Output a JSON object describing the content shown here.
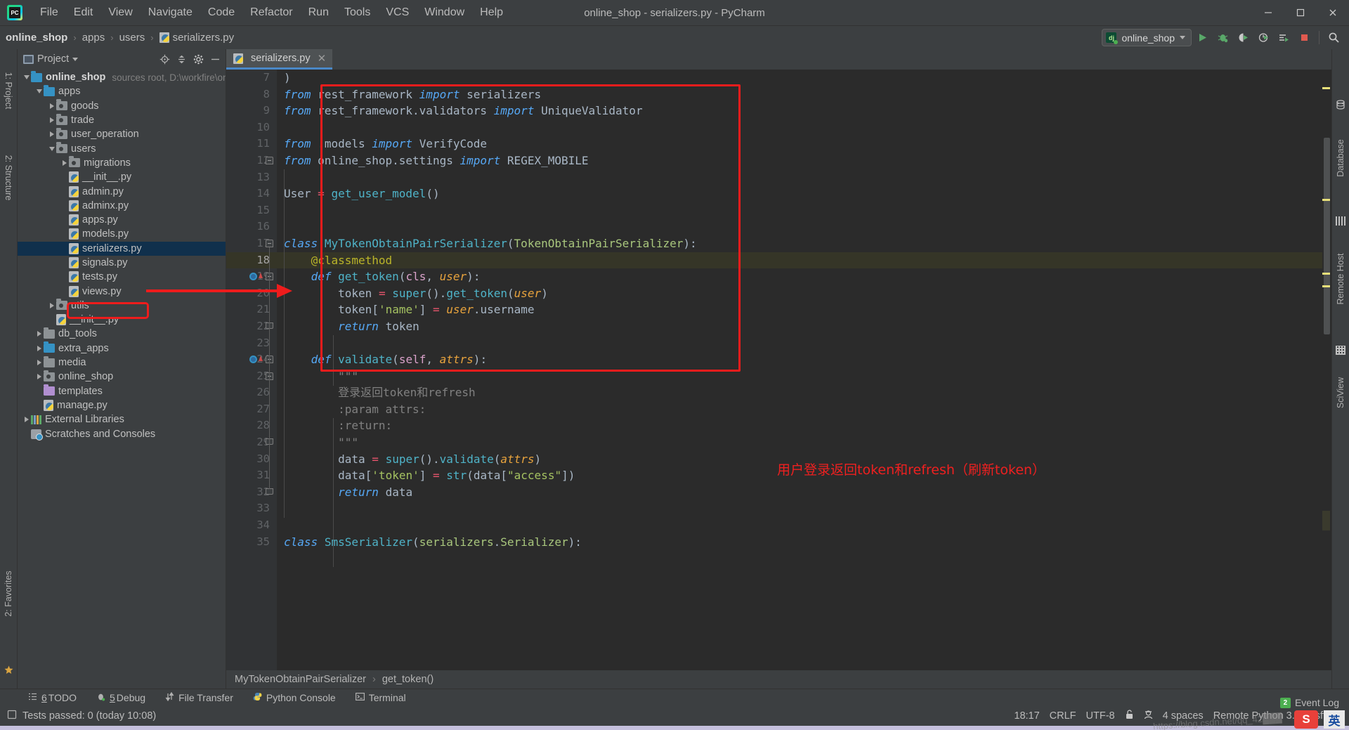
{
  "window": {
    "title": "online_shop - serializers.py - PyCharm",
    "logo_text": "PC",
    "minimize": "—",
    "maximize": "❐",
    "close": "✕"
  },
  "menubar": {
    "items": [
      "File",
      "Edit",
      "View",
      "Navigate",
      "Code",
      "Refactor",
      "Run",
      "Tools",
      "VCS",
      "Window",
      "Help"
    ]
  },
  "breadcrumb": {
    "items": [
      "online_shop",
      "apps",
      "users",
      "serializers.py"
    ],
    "separator": "›"
  },
  "toolbar": {
    "run_config_label": "online_shop",
    "run_config_badge": "dj",
    "buttons": [
      "run-button",
      "debug-button",
      "run-coverage-button",
      "profile-button",
      "run-with-params-button",
      "stop-button",
      "search-everywhere-button"
    ]
  },
  "project_panel": {
    "title": "Project",
    "tools": [
      "locate-icon",
      "collapse-all-icon",
      "settings-icon",
      "hide-icon"
    ],
    "tree": [
      {
        "depth": 0,
        "twist": "open",
        "icon": "folder-blue",
        "label": "online_shop",
        "bold": true,
        "dim": "sources root,  D:\\workfire\\on█"
      },
      {
        "depth": 1,
        "twist": "open",
        "icon": "folder-blue",
        "label": "apps"
      },
      {
        "depth": 2,
        "twist": "closed",
        "icon": "folder-module",
        "label": "goods"
      },
      {
        "depth": 2,
        "twist": "closed",
        "icon": "folder-module",
        "label": "trade"
      },
      {
        "depth": 2,
        "twist": "closed",
        "icon": "folder-module",
        "label": "user_operation"
      },
      {
        "depth": 2,
        "twist": "open",
        "icon": "folder-module",
        "label": "users"
      },
      {
        "depth": 3,
        "twist": "closed",
        "icon": "folder-module",
        "label": "migrations"
      },
      {
        "depth": 3,
        "twist": "none",
        "icon": "py-file",
        "label": "__init__.py"
      },
      {
        "depth": 3,
        "twist": "none",
        "icon": "py-file",
        "label": "admin.py"
      },
      {
        "depth": 3,
        "twist": "none",
        "icon": "py-file",
        "label": "adminx.py"
      },
      {
        "depth": 3,
        "twist": "none",
        "icon": "py-file",
        "label": "apps.py"
      },
      {
        "depth": 3,
        "twist": "none",
        "icon": "py-file",
        "label": "models.py"
      },
      {
        "depth": 3,
        "twist": "none",
        "icon": "py-file",
        "label": "serializers.py",
        "selected": true
      },
      {
        "depth": 3,
        "twist": "none",
        "icon": "py-file",
        "label": "signals.py"
      },
      {
        "depth": 3,
        "twist": "none",
        "icon": "py-file",
        "label": "tests.py"
      },
      {
        "depth": 3,
        "twist": "none",
        "icon": "py-file",
        "label": "views.py"
      },
      {
        "depth": 2,
        "twist": "closed",
        "icon": "folder-module",
        "label": "utils"
      },
      {
        "depth": 2,
        "twist": "none",
        "icon": "py-file",
        "label": "__init__.py"
      },
      {
        "depth": 1,
        "twist": "closed",
        "icon": "folder-gray",
        "label": "db_tools"
      },
      {
        "depth": 1,
        "twist": "closed",
        "icon": "folder-blue",
        "label": "extra_apps"
      },
      {
        "depth": 1,
        "twist": "closed",
        "icon": "folder-gray",
        "label": "media"
      },
      {
        "depth": 1,
        "twist": "closed",
        "icon": "folder-module",
        "label": "online_shop"
      },
      {
        "depth": 1,
        "twist": "none",
        "icon": "folder-purple",
        "label": "templates"
      },
      {
        "depth": 1,
        "twist": "none",
        "icon": "py-file",
        "label": "manage.py"
      },
      {
        "depth": 0,
        "twist": "closed",
        "icon": "ext-lib",
        "label": "External Libraries"
      },
      {
        "depth": 0,
        "twist": "none",
        "icon": "scratch",
        "label": "Scratches and Consoles"
      }
    ]
  },
  "left_tool_strip": {
    "items": [
      "1: Project",
      "2: Structure",
      "2: Favorites"
    ]
  },
  "right_tool_strip": {
    "items": [
      "Database",
      "Remote Host",
      "SciView"
    ]
  },
  "editor": {
    "tab_label": "serializers.py",
    "tab_close": "✕",
    "first_line_number": 7,
    "lines": [
      {
        "n": 7,
        "text": ")"
      },
      {
        "n": 8,
        "text": "from rest_framework import serializers"
      },
      {
        "n": 9,
        "text": "from rest_framework.validators import UniqueValidator"
      },
      {
        "n": 10,
        "text": ""
      },
      {
        "n": 11,
        "text": "from .models import VerifyCode"
      },
      {
        "n": 12,
        "text": "from online_shop.settings import REGEX_MOBILE"
      },
      {
        "n": 13,
        "text": ""
      },
      {
        "n": 14,
        "text": "User = get_user_model()"
      },
      {
        "n": 15,
        "text": ""
      },
      {
        "n": 16,
        "text": ""
      },
      {
        "n": 17,
        "text": "class MyTokenObtainPairSerializer(TokenObtainPairSerializer):"
      },
      {
        "n": 18,
        "text": "    @classmethod",
        "highlight": true
      },
      {
        "n": 19,
        "text": "    def get_token(cls, user):"
      },
      {
        "n": 20,
        "text": "        token = super().get_token(user)"
      },
      {
        "n": 21,
        "text": "        token['name'] = user.username"
      },
      {
        "n": 22,
        "text": "        return token"
      },
      {
        "n": 23,
        "text": ""
      },
      {
        "n": 24,
        "text": "    def validate(self, attrs):"
      },
      {
        "n": 25,
        "text": "        \"\"\""
      },
      {
        "n": 26,
        "text": "        登录返回token和refresh"
      },
      {
        "n": 27,
        "text": "        :param attrs:"
      },
      {
        "n": 28,
        "text": "        :return:"
      },
      {
        "n": 29,
        "text": "        \"\"\""
      },
      {
        "n": 30,
        "text": "        data = super().validate(attrs)"
      },
      {
        "n": 31,
        "text": "        data['token'] = str(data[\"access\"])"
      },
      {
        "n": 32,
        "text": "        return data"
      },
      {
        "n": 33,
        "text": ""
      },
      {
        "n": 34,
        "text": ""
      },
      {
        "n": 35,
        "text": "class SmsSerializer(serializers.Serializer):"
      }
    ],
    "annotation": "用户登录返回token和refresh（刷新token）",
    "annotation_color": "#ef2020",
    "highlight_color": "#ee1c1c",
    "breadcrumb": {
      "class": "MyTokenObtainPairSerializer",
      "method": "get_token()",
      "separator": "›"
    }
  },
  "tool_windows": {
    "items": [
      {
        "num": "6",
        "label": "TODO",
        "icon": "todo-icon"
      },
      {
        "num": "5",
        "label": "Debug",
        "icon": "debug-icon"
      },
      {
        "num": "",
        "label": "File Transfer",
        "icon": "transfer-icon"
      },
      {
        "num": "",
        "label": "Python Console",
        "icon": "python-icon"
      },
      {
        "num": "",
        "label": "Terminal",
        "icon": "terminal-icon"
      }
    ]
  },
  "status_bar": {
    "message": "Tests passed: 0 (today 10:08)",
    "time": "18:17",
    "line_separator": "CRLF",
    "encoding": "UTF-8",
    "indent": "4 spaces",
    "interpreter": "Remote Python 3.7.0 (sft...)",
    "event_log": "Event Log",
    "event_count": "2",
    "watermark": "https://blog.csdn.net/qq_42███"
  }
}
